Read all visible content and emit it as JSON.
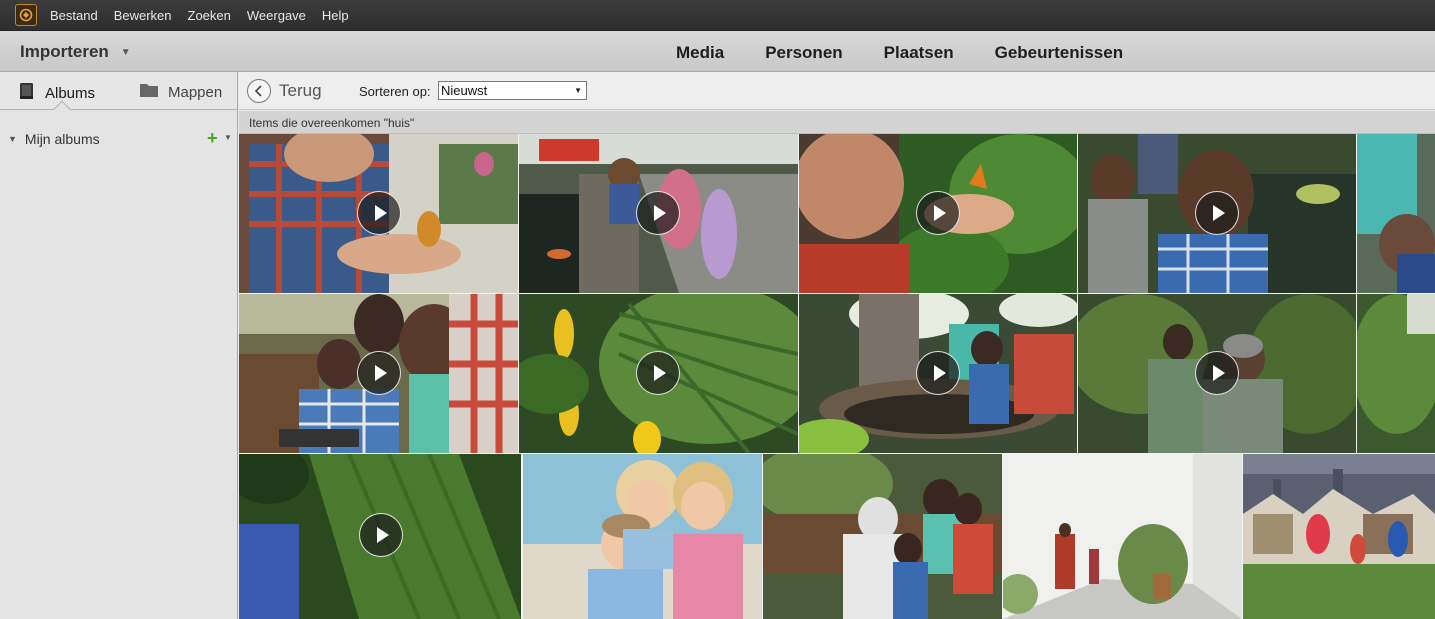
{
  "menu": {
    "logo_icon": "elements-organizer-logo-icon",
    "items": [
      "Bestand",
      "Bewerken",
      "Zoeken",
      "Weergave",
      "Help"
    ]
  },
  "top": {
    "import_label": "Importeren",
    "views": [
      "Media",
      "Personen",
      "Plaatsen",
      "Gebeurtenissen"
    ]
  },
  "sidebar": {
    "tabs": [
      {
        "label": "Albums",
        "icon": "album-book-icon",
        "active": true
      },
      {
        "label": "Mappen",
        "icon": "folder-icon",
        "active": false
      }
    ],
    "my_albums_label": "Mijn albums"
  },
  "toolbar": {
    "back_label": "Terug",
    "sort_label": "Sorteren op:",
    "sort_value": "Nieuwst"
  },
  "results": {
    "match_text": "Items die overeenkomen \"huis\""
  },
  "media": [
    {
      "kind": "video",
      "desc": "boy holding butterfly"
    },
    {
      "kind": "video",
      "desc": "children at koi pond"
    },
    {
      "kind": "video",
      "desc": "boy with butterfly in hand"
    },
    {
      "kind": "video",
      "desc": "boys at pond"
    },
    {
      "kind": "photo",
      "desc": "partial view"
    },
    {
      "kind": "video",
      "desc": "family with tablet"
    },
    {
      "kind": "video",
      "desc": "yellow flowers and leaves"
    },
    {
      "kind": "video",
      "desc": "family at fountain"
    },
    {
      "kind": "video",
      "desc": "boy and father looking up"
    },
    {
      "kind": "photo",
      "desc": "partial greenhouse"
    },
    {
      "kind": "video",
      "desc": "green leaf close-up"
    },
    {
      "kind": "photo",
      "desc": "three children smiling"
    },
    {
      "kind": "photo",
      "desc": "family on bench"
    },
    {
      "kind": "photo",
      "desc": "greenhouse walkway"
    },
    {
      "kind": "photo",
      "desc": "children jumping in park"
    }
  ],
  "colors": {
    "menubar_bg": "#333333",
    "accent_green": "#3fa626"
  }
}
